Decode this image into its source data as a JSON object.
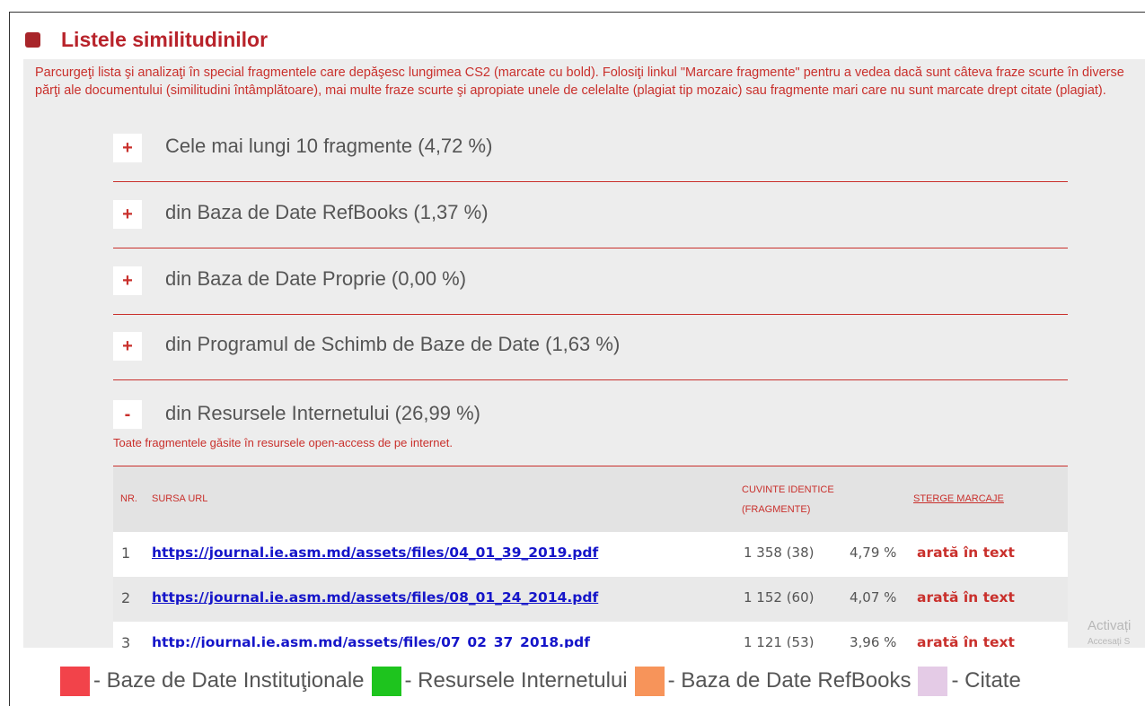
{
  "section": {
    "title": "Listele similitudinilor",
    "intro": "Parcurgeţi lista şi analizaţi în special fragmentele care depăşesc lungimea CS2 (marcate cu bold). Folosiţi linkul \"Marcare fragmente\" pentru a vedea dacă sunt câteva fraze scurte în diverse părţi ale documentului (similitudini întâmplătoare), mai multe fraze scurte şi apropiate unele de celelalte (plagiat tip mozaic) sau fragmente mari care nu sunt marcate drept citate (plagiat)."
  },
  "accordion": [
    {
      "toggle": "+",
      "label": "Cele mai lungi 10 fragmente (4,72 %)"
    },
    {
      "toggle": "+",
      "label": "din Baza de Date RefBooks (1,37 %)"
    },
    {
      "toggle": "+",
      "label": "din Baza de Date Proprie (0,00 %)"
    },
    {
      "toggle": "+",
      "label": "din Programul de Schimb de Baze de Date (1,63 %)"
    },
    {
      "toggle": "-",
      "label": "din Resursele Internetului (26,99 %)"
    }
  ],
  "internet_note": "Toate fragmentele găsite în resursele open-access de pe internet.",
  "table": {
    "headers": {
      "nr": "NR.",
      "url": "SURSA URL",
      "words_1": "CUVINTE IDENTICE",
      "words_2": "(FRAGMENTE)",
      "clear": "STERGE MARCAJE"
    },
    "rows": [
      {
        "nr": "1",
        "url": "https://journal.ie.asm.md/assets/files/04_01_39_2019.pdf",
        "words": "1 358 (38)",
        "pct": "4,79 %",
        "show": "arată în text"
      },
      {
        "nr": "2",
        "url": "https://journal.ie.asm.md/assets/files/08_01_24_2014.pdf",
        "words": "1 152 (60)",
        "pct": "4,07 %",
        "show": "arată în text"
      },
      {
        "nr": "3",
        "url": "http://journal.ie.asm.md/assets/files/07_02_37_2018.pdf",
        "words": "1 121 (53)",
        "pct": "3,96 %",
        "show": "arată în text"
      }
    ]
  },
  "watermark": {
    "line1": "Activați",
    "line2": "Accesați S"
  },
  "legend": [
    {
      "color": "#f2434a",
      "label": "- Baze de Date Instituţionale"
    },
    {
      "color": "#1ec41e",
      "label": "- Resursele Internetului"
    },
    {
      "color": "#f7945a",
      "label": "- Baza de Date RefBooks"
    },
    {
      "color": "#e4cbe6",
      "label": "- Citate"
    }
  ]
}
